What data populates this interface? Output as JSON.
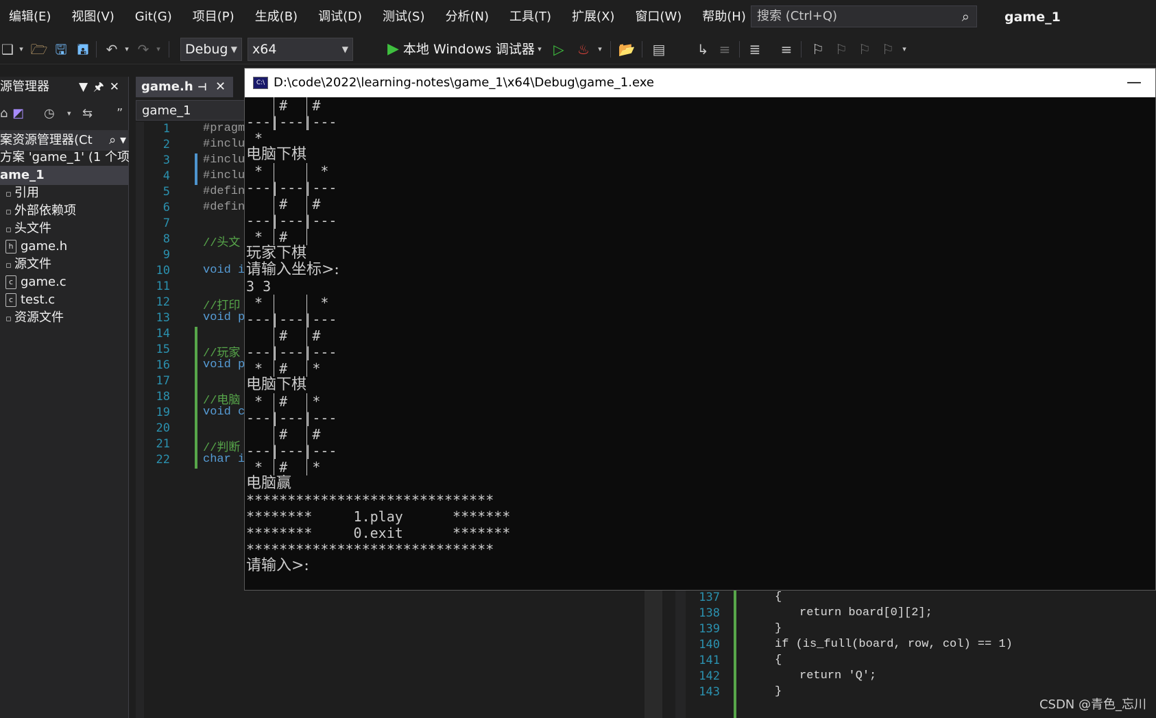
{
  "menubar": {
    "items": [
      "编辑(E)",
      "视图(V)",
      "Git(G)",
      "项目(P)",
      "生成(B)",
      "调试(D)",
      "测试(S)",
      "分析(N)",
      "工具(T)",
      "扩展(X)",
      "窗口(W)",
      "帮助(H)"
    ],
    "search_placeholder": "搜索 (Ctrl+Q)",
    "app_title": "game_1"
  },
  "toolbar": {
    "configuration": "Debug",
    "platform": "x64",
    "run_label": "本地 Windows 调试器"
  },
  "solution_explorer": {
    "title": "源管理器",
    "search_text": "案资源管理器(Ct",
    "items": [
      {
        "label": "方案 'game_1' (1 个项目",
        "icon": "solution-icon"
      },
      {
        "label": "ame_1",
        "icon": "project-icon",
        "selected": true
      },
      {
        "label": "引用",
        "icon": "references-icon"
      },
      {
        "label": "外部依赖项",
        "icon": "dependency-icon"
      },
      {
        "label": "头文件",
        "icon": "folder-icon"
      },
      {
        "label": "game.h",
        "icon": "header-file-icon"
      },
      {
        "label": "源文件",
        "icon": "folder-icon"
      },
      {
        "label": "game.c",
        "icon": "c-file-icon"
      },
      {
        "label": "test.c",
        "icon": "c-file-icon"
      },
      {
        "label": "资源文件",
        "icon": "folder-icon"
      }
    ]
  },
  "editor": {
    "tab_label": "game.h",
    "nav_label": "game_1",
    "line_numbers": [
      "1",
      "2",
      "3",
      "4",
      "5",
      "6",
      "7",
      "8",
      "9",
      "10",
      "11",
      "12",
      "13",
      "14",
      "15",
      "16",
      "17",
      "18",
      "19",
      "20",
      "21",
      "22"
    ],
    "code_lines": [
      "#pragm",
      "#inclu",
      "#inclu",
      "#inclu",
      "#defin",
      "#defin",
      "",
      "//头文",
      "",
      "void i",
      "",
      "//打印",
      "void p",
      "",
      "//玩家",
      "void p",
      "",
      "//电脑",
      "void c",
      "",
      "//判断",
      "char i"
    ]
  },
  "editor2": {
    "line_numbers": [
      "137",
      "138",
      "139",
      "140",
      "141",
      "142",
      "143"
    ],
    "lines": [
      {
        "text": "{"
      },
      {
        "text": "return board[0][2];"
      },
      {
        "text": "}"
      },
      {
        "text": "if (is_full(board, row, col) == 1)"
      },
      {
        "text": "{"
      },
      {
        "text": "return 'Q';"
      },
      {
        "text": "}"
      }
    ]
  },
  "console": {
    "title": "D:\\code\\2022\\learning-notes\\game_1\\x64\\Debug\\game_1.exe",
    "lines": [
      "    #   #",
      "---|---|---",
      " *",
      "电脑下棋",
      " *       *",
      "---|---|---",
      "    #   #",
      "---|---|---",
      " *  #",
      "玩家下棋",
      "请输入坐标>:",
      "3 3",
      " *       *",
      "---|---|---",
      "    #   #",
      "---|---|---",
      " *  #   *",
      "电脑下棋",
      " *  #   *",
      "---|---|---",
      "    #   #",
      "---|---|---",
      " *  #   *",
      "电脑赢",
      "******************************",
      "********     1.play      *******",
      "********     0.exit      *******",
      "******************************",
      "请输入>:"
    ]
  },
  "watermark": "CSDN @青色_忘川"
}
